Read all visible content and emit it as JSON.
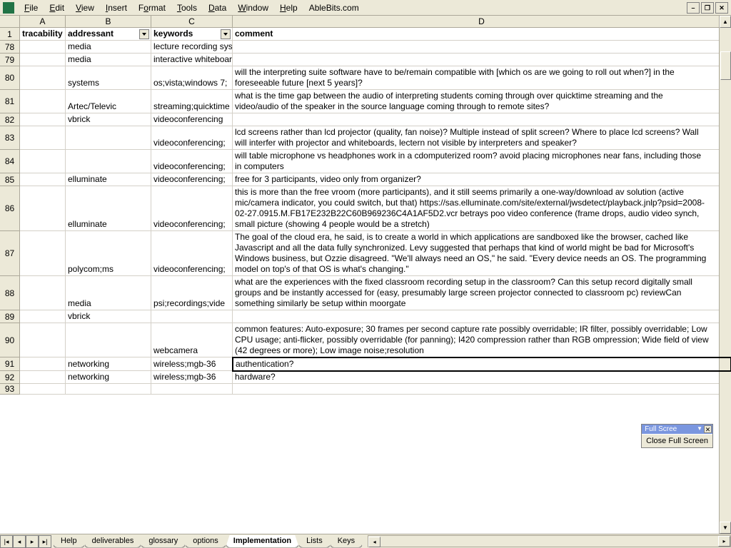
{
  "menu": {
    "file": "File",
    "edit": "Edit",
    "view": "View",
    "insert": "Insert",
    "format": "Format",
    "tools": "Tools",
    "data": "Data",
    "window": "Window",
    "help": "Help",
    "ablebits": "AbleBits.com"
  },
  "window_controls": {
    "min": "–",
    "restore": "❐",
    "close": "✕"
  },
  "columns": {
    "A": "A",
    "B": "B",
    "C": "C",
    "D": "D"
  },
  "headers": {
    "tracability": "tracability",
    "addressant": "addressant",
    "keywords": "keywords",
    "comment": "comment"
  },
  "rows": [
    {
      "n": "78",
      "b": "media",
      "c": "lecture recording system",
      "d": ""
    },
    {
      "n": "79",
      "b": "media",
      "c": "interactive whiteboard",
      "d": ""
    },
    {
      "n": "80",
      "b": "systems",
      "c": "os;vista;windows 7;",
      "d": "will the interpreting suite software have to be/remain compatible with [which os are we going to roll out when?] in the foreseeable future [next 5 years]?"
    },
    {
      "n": "81",
      "b": "Artec/Televic",
      "c": "streaming;quicktime",
      "d": "what is the time gap between the audio of interpreting students coming through over quicktime streaming and the video/audio of the speaker in the source language coming through to remote sites?"
    },
    {
      "n": "82",
      "b": "vbrick",
      "c": "videoconferencing",
      "d": ""
    },
    {
      "n": "83",
      "b": "",
      "c": "videoconferencing;",
      "d": "lcd screens rather than lcd projector (quality, fan noise)? Multiple instead of split screen? Where to place lcd screens? Wall will interfer with projector and whiteboards, lectern not visible by interpreters and speaker?"
    },
    {
      "n": "84",
      "b": "",
      "c": "videoconferencing;",
      "d": "will table microphone vs headphones work in a cdomputerized room? avoid placing microphones near fans, including those in computers"
    },
    {
      "n": "85",
      "b": "elluminate",
      "c": "videoconferencing;",
      "d": "free for 3 participants, video only from organizer?"
    },
    {
      "n": "86",
      "b": "elluminate",
      "c": "videoconferencing;",
      "d": "this is more than the free vroom (more participants), and it still seems primarily a one-way/download  av solution (active mic/camera indicator, you could switch, but that) https://sas.elluminate.com/site/external/jwsdetect/playback.jnlp?psid=2008-02-27.0915.M.FB17E232B22C60B969236C4A1AF5D2.vcr betrays poo video conference (frame drops, audio video synch, small picture (showing 4 people would be a stretch)"
    },
    {
      "n": "87",
      "b": "polycom;ms",
      "c": "videoconferencing;",
      "d": "The goal of the cloud era, he said, is to create a world in which applications are sandboxed like the browser, cached like Javascript and all the data fully synchronized. Levy suggested that perhaps that kind of world might be bad for Microsoft's Windows business, but Ozzie disagreed.  \"We'll always need an OS,\" he said. \"Every device needs an OS. The programming model on top's of that OS is what's changing.\""
    },
    {
      "n": "88",
      "b": "media",
      "c": "psi;recordings;vide",
      "d": "what are the experiences with the fixed classroom recording setup in the classroom? Can this setup record digitally small groups and be instantly accessed for (easy, presumably large screen projector connected to classroom pc) reviewCan something similarly  be setup within moorgate"
    },
    {
      "n": "89",
      "b": "vbrick",
      "c": "",
      "d": ""
    },
    {
      "n": "90",
      "b": "",
      "c": "webcamera",
      "d": "common features: Auto-exposure; 30 frames per second capture rate possibly overridable; IR filter, possibly overridable; Low CPU usage; anti-flicker, possibly overridable (for panning); I420 compression rather than RGB ompression; Wide field of view (42 degrees or more); Low image noise;resolution"
    },
    {
      "n": "91",
      "b": "networking",
      "c": "wireless;mgb-36",
      "d": "authentication?"
    },
    {
      "n": "92",
      "b": "networking",
      "c": "wireless;mgb-36",
      "d": "hardware?"
    },
    {
      "n": "93",
      "b": "",
      "c": "",
      "d": ""
    }
  ],
  "tabs": {
    "help": "Help",
    "deliverables": "deliverables",
    "glossary": "glossary",
    "options": "options",
    "implementation": "Implementation",
    "lists": "Lists",
    "keys": "Keys"
  },
  "fullscreen": {
    "title": "Full Scree",
    "close_label": "Close Full Screen"
  }
}
